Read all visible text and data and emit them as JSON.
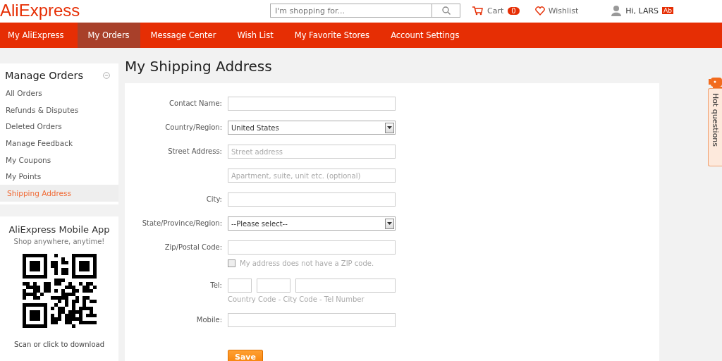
{
  "header": {
    "logo": "AliExpress",
    "search_placeholder": "I'm shopping for...",
    "cart": {
      "label": "Cart",
      "count": "0"
    },
    "wishlist": "Wishlist",
    "user": {
      "greeting": "Hi, LARS",
      "badge": "Ab"
    }
  },
  "nav": [
    {
      "label": "My AliExpress",
      "selected": false
    },
    {
      "label": "My Orders",
      "selected": true
    },
    {
      "label": "Message Center",
      "selected": false
    },
    {
      "label": "Wish List",
      "selected": false
    },
    {
      "label": "My Favorite Stores",
      "selected": false
    },
    {
      "label": "Account Settings",
      "selected": false
    }
  ],
  "sidebar": {
    "title": "Manage Orders",
    "expanded": true,
    "items": [
      {
        "label": "All Orders",
        "selected": false
      },
      {
        "label": "Refunds & Disputes",
        "selected": false
      },
      {
        "label": "Deleted Orders",
        "selected": false
      },
      {
        "label": "Manage Feedback",
        "selected": false
      },
      {
        "label": "My Coupons",
        "selected": false
      },
      {
        "label": "My Points",
        "selected": false
      },
      {
        "label": "Shipping Address",
        "selected": true
      }
    ]
  },
  "app_promo": {
    "title": "AliExpress Mobile App",
    "subtitle": "Shop anywhere, anytime!",
    "caption": "Scan or click to download"
  },
  "main": {
    "title": "My Shipping Address",
    "fields": [
      {
        "kind": "text",
        "label": "Contact Name:"
      },
      {
        "kind": "select",
        "label": "Country/Region:",
        "value": "United States"
      },
      {
        "kind": "text",
        "label": "Street Address:",
        "placeholder": "Street address"
      },
      {
        "kind": "text",
        "placeholder": "Apartment, suite, unit etc. (optional)"
      },
      {
        "kind": "text",
        "label": "City:"
      },
      {
        "kind": "select",
        "label": "State/Province/Region:",
        "value": "--Please select--"
      },
      {
        "kind": "text",
        "label": "Zip/Postal Code:",
        "checkbox": {
          "label": "My address does not have a ZIP code.",
          "checked": false
        }
      },
      {
        "kind": "tel",
        "label": "Tel:",
        "hint": "Country Code - City Code - Tel Number"
      },
      {
        "kind": "text",
        "label": "Mobile:"
      }
    ],
    "save_button": "Save"
  },
  "help_tab": {
    "label": "Hot questions"
  }
}
